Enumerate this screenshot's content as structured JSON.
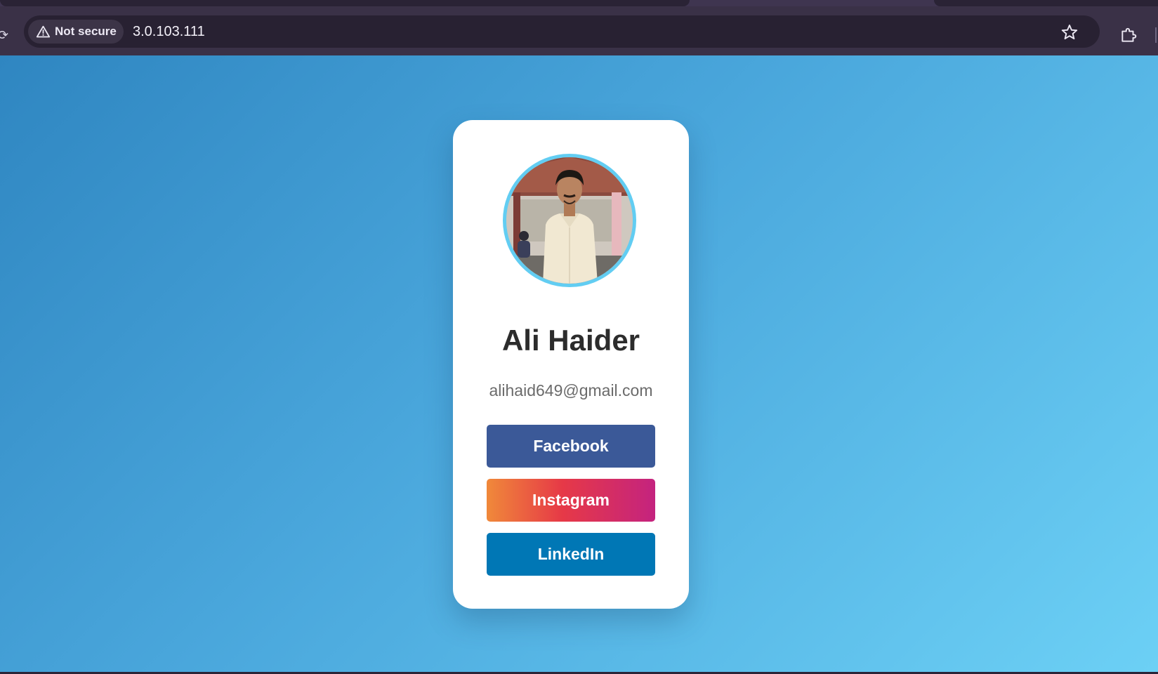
{
  "browser": {
    "security_label": "Not secure",
    "url": "3.0.103.111",
    "icons": {
      "security": "warning-triangle-icon",
      "bookmark": "star-icon",
      "extensions": "puzzle-piece-icon"
    }
  },
  "profile": {
    "name": "Ali Haider",
    "email": "alihaid649@gmail.com",
    "avatar_alt": "profile-photo"
  },
  "links": {
    "facebook": "Facebook",
    "instagram": "Instagram",
    "linkedin": "LinkedIn"
  },
  "colors": {
    "background_start": "#2f86c1",
    "background_end": "#6cd0f5",
    "avatar_ring": "#62cdf2",
    "facebook": "#3b5998",
    "instagram_start": "#f0893a",
    "instagram_mid": "#e63947",
    "instagram_end": "#c4237f",
    "linkedin": "#0077b5"
  }
}
